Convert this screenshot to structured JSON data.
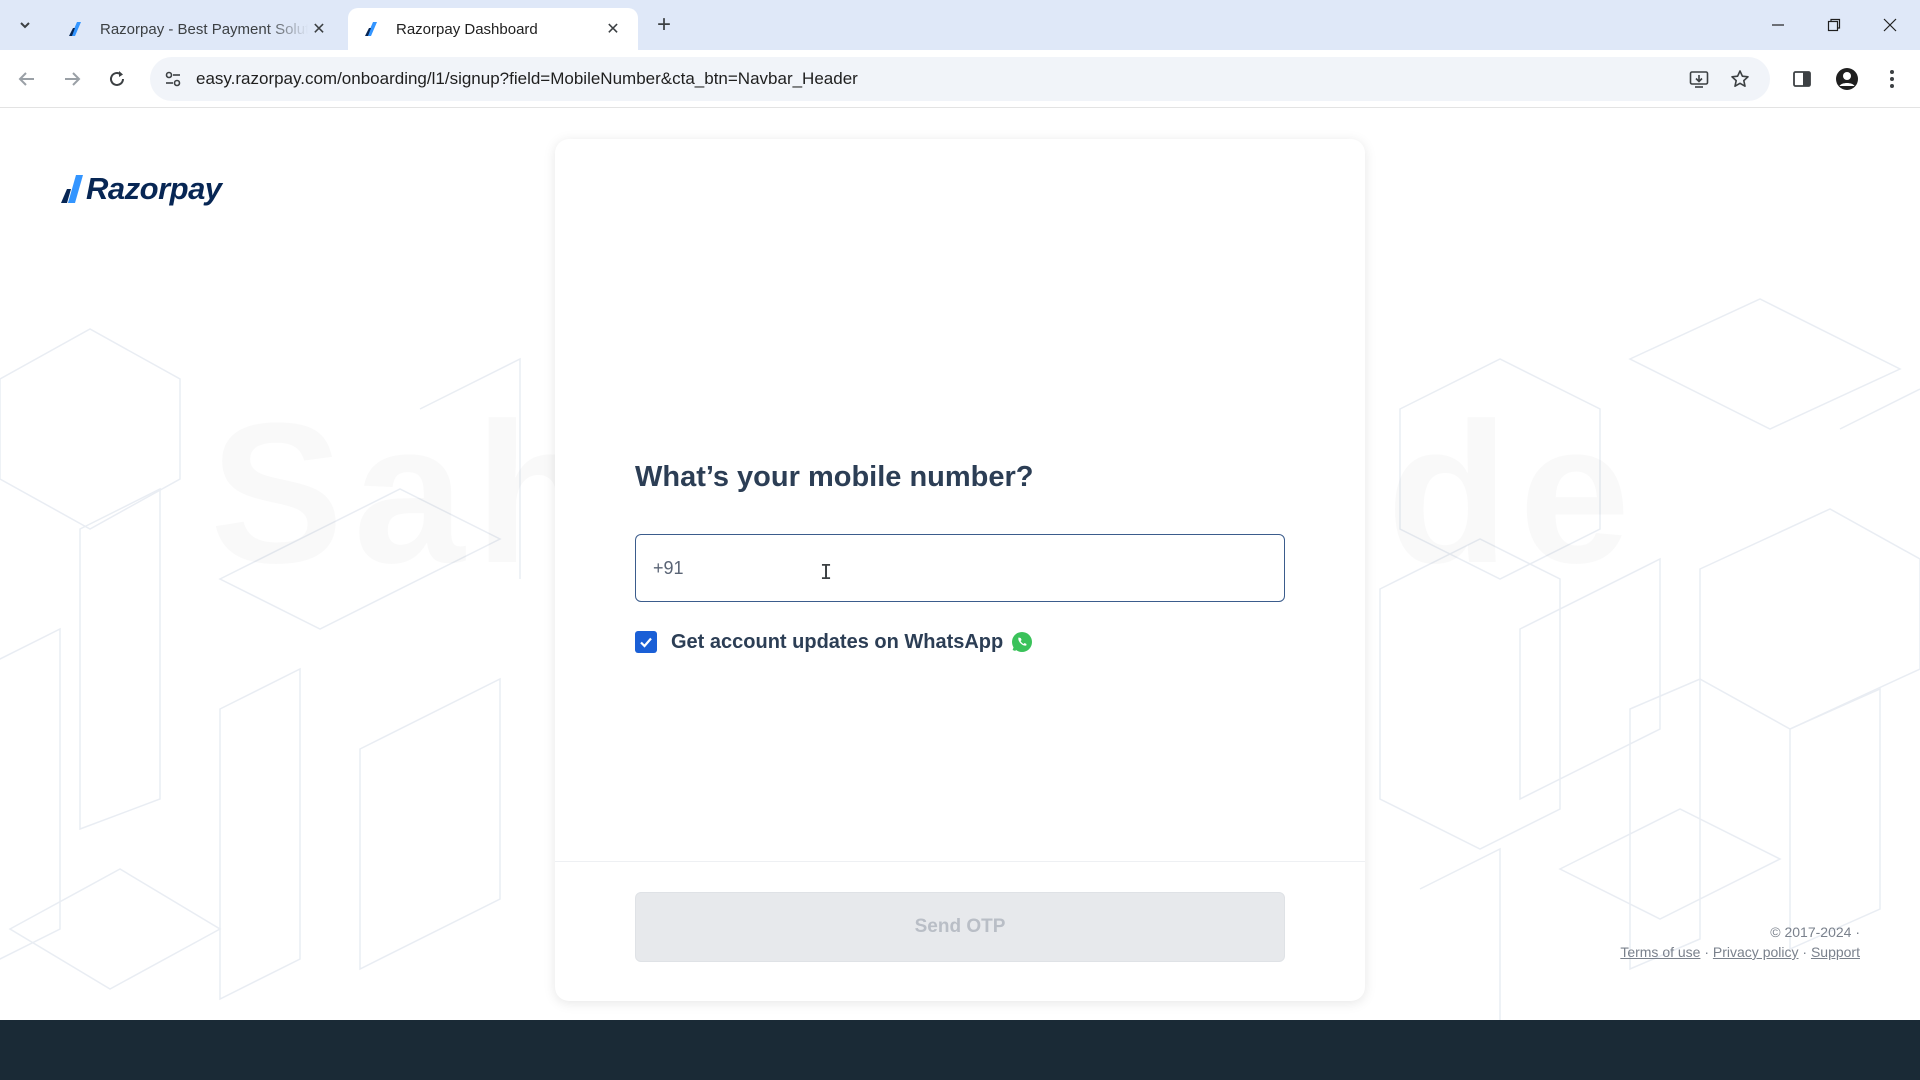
{
  "browser": {
    "tabs": [
      {
        "title": "Razorpay - Best Payment Solution for Online Payments India",
        "active": false
      },
      {
        "title": "Razorpay Dashboard",
        "active": true
      }
    ],
    "url": "easy.razorpay.com/onboarding/l1/signup?field=MobileNumber&cta_btn=Navbar_Header"
  },
  "brand": {
    "name": "Razorpay",
    "color": "#072654",
    "accent": "#3395ff"
  },
  "form": {
    "question": "What’s your mobile number?",
    "country_code": "+91",
    "phone_value": "",
    "whatsapp_opt_in_label": "Get account updates on WhatsApp",
    "whatsapp_checked": true,
    "submit_label": "Send OTP",
    "submit_enabled": false
  },
  "footer": {
    "copyright": "© 2017-2024 ·",
    "links": [
      "Terms of use",
      "Privacy policy",
      "Support"
    ],
    "separator": "·"
  },
  "watermark": "Sahil R Guide"
}
